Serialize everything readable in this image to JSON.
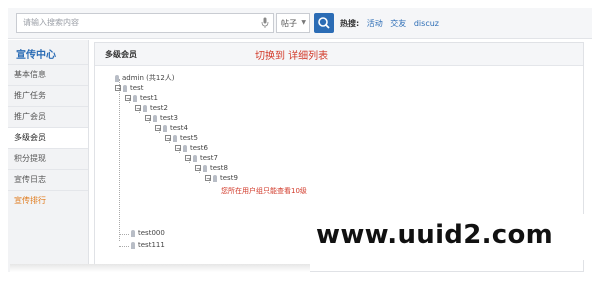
{
  "search": {
    "placeholder": "请输入搜索内容",
    "select_label": "帖子"
  },
  "hot": {
    "label": "热搜:",
    "links": [
      "活动",
      "交友",
      "discuz"
    ]
  },
  "sidebar": {
    "title": "宣传中心",
    "items": [
      {
        "label": "基本信息"
      },
      {
        "label": "推广任务"
      },
      {
        "label": "推广会员"
      },
      {
        "label": "多级会员"
      },
      {
        "label": "积分提现"
      },
      {
        "label": "宣传日志"
      },
      {
        "label": "宣传排行"
      }
    ]
  },
  "main": {
    "title": "多级会员",
    "switch_label": "切换到 详细列表",
    "root": "admin (共12人)",
    "tree": [
      "test",
      "test1",
      "test2",
      "test3",
      "test4",
      "test5",
      "test6",
      "test7",
      "test8",
      "test9"
    ],
    "warning": "您所在用户组只能查看10级",
    "extra": [
      "test000",
      "test111"
    ]
  },
  "watermark": "www.uuid2.com"
}
